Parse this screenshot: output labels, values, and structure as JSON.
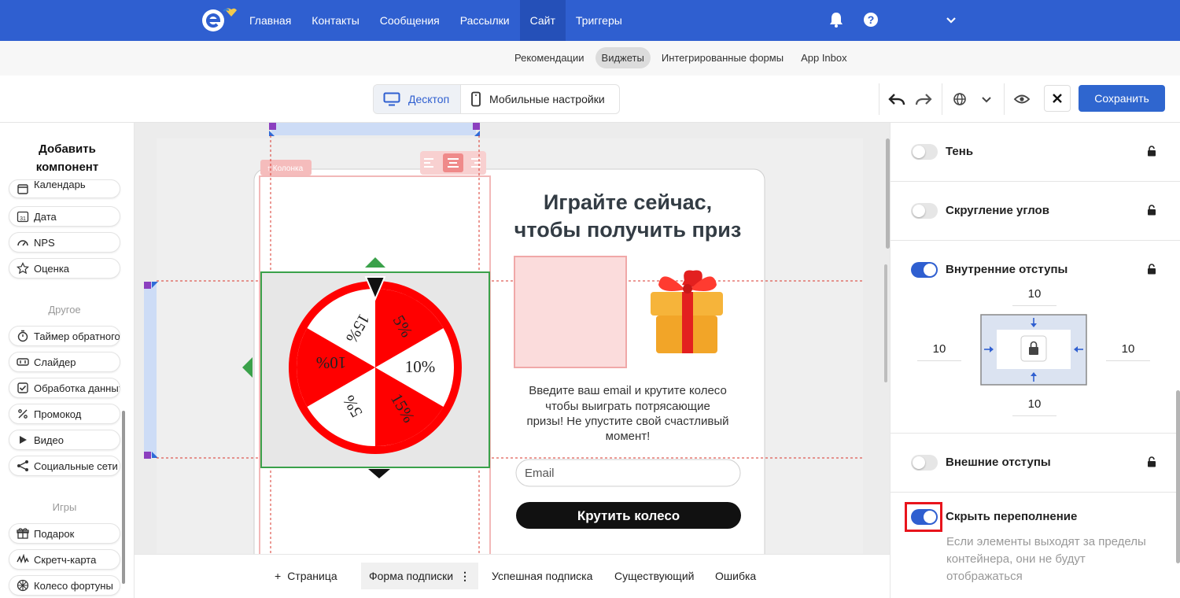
{
  "nav": {
    "items": [
      "Главная",
      "Контакты",
      "Сообщения",
      "Рассылки",
      "Сайт",
      "Триггеры"
    ],
    "active": "Сайт"
  },
  "subnav": {
    "items": [
      "Рекомендации",
      "Виджеты",
      "Интегрированные формы",
      "App Inbox"
    ],
    "active": "Виджеты"
  },
  "toolbar": {
    "desktop_label": "Десктоп",
    "mobile_label": "Мобильные настройки",
    "save_label": "Сохранить"
  },
  "left_panel": {
    "title_line1": "Добавить",
    "title_line2": "компонент",
    "components_top": [
      {
        "label": "Календарь",
        "icon": "calendar-icon"
      },
      {
        "label": "Дата",
        "icon": "date-icon"
      },
      {
        "label": "NPS",
        "icon": "gauge-icon"
      },
      {
        "label": "Оценка",
        "icon": "star-icon"
      }
    ],
    "section_other": "Другое",
    "components_other": [
      {
        "label": "Таймер обратного отсчета",
        "icon": "timer-icon"
      },
      {
        "label": "Слайдер",
        "icon": "slider-icon"
      },
      {
        "label": "Обработка данных",
        "icon": "checkbox-icon"
      },
      {
        "label": "Промокод",
        "icon": "percent-icon"
      },
      {
        "label": "Видео",
        "icon": "play-icon"
      },
      {
        "label": "Социальные сети",
        "icon": "share-icon"
      }
    ],
    "section_games": "Игры",
    "components_games": [
      {
        "label": "Подарок",
        "icon": "gift-icon"
      },
      {
        "label": "Скретч-карта",
        "icon": "scratch-icon"
      },
      {
        "label": "Колесо фортуны",
        "icon": "wheel-icon"
      }
    ]
  },
  "canvas": {
    "column_tag": "Колонка",
    "heading_line1": "Играйте сейчас,",
    "heading_line2": "чтобы получить приз",
    "body_lines": [
      "Введите ваш email и крутите колесо",
      "чтобы выиграть потрясающие",
      "призы! Не упустите свой счастливый",
      "момент!"
    ],
    "email_placeholder": "Email",
    "spin_button": "Крутить колесо",
    "wheel_segments": [
      "5%",
      "10%",
      "15%",
      "5%",
      "10%",
      "15%"
    ]
  },
  "bottom_tabs": {
    "add_page": "Страница",
    "items": [
      "Форма подписки",
      "Успешная подписка",
      "Существующий",
      "Ошибка"
    ],
    "active": "Форма подписки"
  },
  "right_panel": {
    "shadow": {
      "label": "Тень",
      "enabled": false
    },
    "radius": {
      "label": "Скругление углов",
      "enabled": false
    },
    "padding": {
      "label": "Внутренние отступы",
      "enabled": true,
      "top": "10",
      "left": "10",
      "right": "10",
      "bottom": "10"
    },
    "margin": {
      "label": "Внешние отступы",
      "enabled": false
    },
    "overflow": {
      "label": "Скрыть переполнение",
      "enabled": true,
      "description": "Если элементы выходят за пределы контейнера, они не будут отображаться"
    }
  },
  "colors": {
    "brand_blue": "#2f5fd0",
    "wheel_red": "#ff0000",
    "highlight_red": "#e8141c"
  }
}
